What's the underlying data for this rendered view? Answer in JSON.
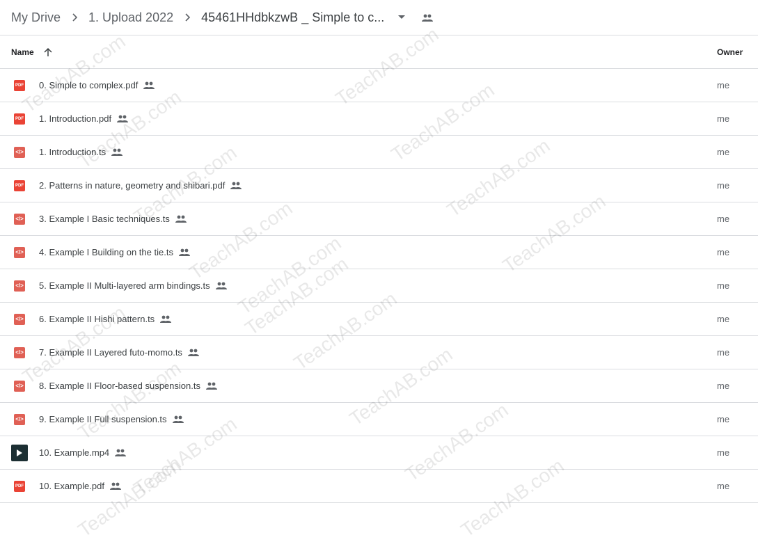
{
  "breadcrumb": {
    "items": [
      "My Drive",
      "1. Upload 2022",
      "45461HHdbkzwB _ Simple to c..."
    ],
    "separator_icon": "chevron-right-icon",
    "dropdown_icon": "arrow-drop-down-icon",
    "shared_icon": "people-icon"
  },
  "columns": {
    "name": "Name",
    "sort_icon": "arrow-up-icon",
    "owner": "Owner"
  },
  "files": [
    {
      "name": "0. Simple to complex.pdf",
      "type": "pdf",
      "icon": "pdf-icon",
      "icon_label": "PDF",
      "shared": true,
      "owner": "me"
    },
    {
      "name": "1. Introduction.pdf",
      "type": "pdf",
      "icon": "pdf-icon",
      "icon_label": "PDF",
      "shared": true,
      "owner": "me"
    },
    {
      "name": "1. Introduction.ts",
      "type": "code",
      "icon": "code-icon",
      "icon_label": "</>",
      "shared": true,
      "owner": "me"
    },
    {
      "name": "2. Patterns in nature, geometry and shibari.pdf",
      "type": "pdf",
      "icon": "pdf-icon",
      "icon_label": "PDF",
      "shared": true,
      "owner": "me"
    },
    {
      "name": "3. Example I Basic techniques.ts",
      "type": "code",
      "icon": "code-icon",
      "icon_label": "</>",
      "shared": true,
      "owner": "me"
    },
    {
      "name": "4. Example I Building on the tie.ts",
      "type": "code",
      "icon": "code-icon",
      "icon_label": "</>",
      "shared": true,
      "owner": "me"
    },
    {
      "name": "5. Example II Multi-layered arm bindings.ts",
      "type": "code",
      "icon": "code-icon",
      "icon_label": "</>",
      "shared": true,
      "owner": "me"
    },
    {
      "name": "6. Example II Hishi pattern.ts",
      "type": "code",
      "icon": "code-icon",
      "icon_label": "</>",
      "shared": true,
      "owner": "me"
    },
    {
      "name": "7. Example II Layered futo-momo.ts",
      "type": "code",
      "icon": "code-icon",
      "icon_label": "</>",
      "shared": true,
      "owner": "me"
    },
    {
      "name": "8. Example II Floor-based suspension.ts",
      "type": "code",
      "icon": "code-icon",
      "icon_label": "</>",
      "shared": true,
      "owner": "me"
    },
    {
      "name": "9. Example II Full suspension.ts",
      "type": "code",
      "icon": "code-icon",
      "icon_label": "</>",
      "shared": true,
      "owner": "me"
    },
    {
      "name": "10. Example.mp4",
      "type": "video",
      "icon": "video-play-icon",
      "icon_label": "",
      "shared": true,
      "owner": "me"
    },
    {
      "name": "10. Example.pdf",
      "type": "pdf",
      "icon": "pdf-icon",
      "icon_label": "PDF",
      "shared": true,
      "owner": "me"
    }
  ],
  "watermark": "TeachAB.com"
}
